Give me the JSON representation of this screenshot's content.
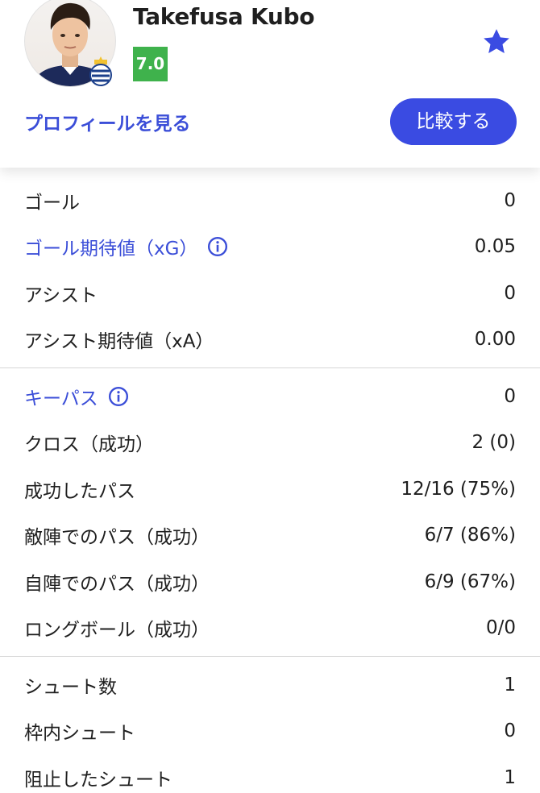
{
  "player": {
    "name": "Takefusa Kubo",
    "rating": "7.0",
    "profile_link": "プロフィールを見る",
    "compare_button": "比較する",
    "favorite_icon": "star-icon"
  },
  "colors": {
    "accent": "#3a4be2",
    "link": "#3b4ed8",
    "rating_bg": "#3fb24c",
    "divider": "#d7d7d7"
  },
  "sections": [
    {
      "rows": [
        {
          "label": "ゴール",
          "value": "0",
          "link": false,
          "info": false
        },
        {
          "label": "ゴール期待値（xG）",
          "value": "0.05",
          "link": true,
          "info": true
        },
        {
          "label": "アシスト",
          "value": "0",
          "link": false,
          "info": false
        },
        {
          "label": "アシスト期待値（xA）",
          "value": "0.00",
          "link": false,
          "info": false
        }
      ]
    },
    {
      "rows": [
        {
          "label": "キーパス",
          "value": "0",
          "link": true,
          "info": true
        },
        {
          "label": "クロス（成功）",
          "value": "2 (0)",
          "link": false,
          "info": false
        },
        {
          "label": "成功したパス",
          "value": "12/16 (75%)",
          "link": false,
          "info": false
        },
        {
          "label": "敵陣でのパス（成功）",
          "value": "6/7 (86%)",
          "link": false,
          "info": false
        },
        {
          "label": "自陣でのパス（成功）",
          "value": "6/9 (67%)",
          "link": false,
          "info": false
        },
        {
          "label": "ロングボール（成功）",
          "value": "0/0",
          "link": false,
          "info": false
        }
      ]
    },
    {
      "rows": [
        {
          "label": "シュート数",
          "value": "1",
          "link": false,
          "info": false
        },
        {
          "label": "枠内シュート",
          "value": "0",
          "link": false,
          "info": false
        },
        {
          "label": "阻止したシュート",
          "value": "1",
          "link": false,
          "info": false
        }
      ]
    }
  ]
}
